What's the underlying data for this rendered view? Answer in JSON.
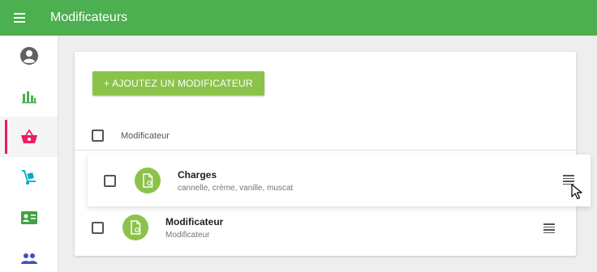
{
  "app": {
    "title": "Modificateurs",
    "accent_color": "#4caf50",
    "button_color": "#8bc34a",
    "active_nav_color": "#e91e63"
  },
  "sidebar": {
    "items": [
      {
        "icon": "account-circle-icon",
        "color": "#616161",
        "active": false
      },
      {
        "icon": "bar-chart-icon",
        "color": "#4caf50",
        "active": false
      },
      {
        "icon": "shopping-basket-icon",
        "color": "#e91e63",
        "active": true
      },
      {
        "icon": "hand-truck-icon",
        "color": "#00acc1",
        "active": false
      },
      {
        "icon": "contact-card-icon",
        "color": "#43a047",
        "active": false
      },
      {
        "icon": "people-icon",
        "color": "#3f51b5",
        "active": false
      }
    ]
  },
  "main": {
    "add_button_label": "+ AJOUTEZ UN MODIFICATEUR",
    "table_header": "Modificateur",
    "rows": [
      {
        "title": "Charges",
        "subtitle": "cannelle, crème, vanille, muscat"
      },
      {
        "title": "Modificateur",
        "subtitle": "Modificateur"
      }
    ]
  }
}
